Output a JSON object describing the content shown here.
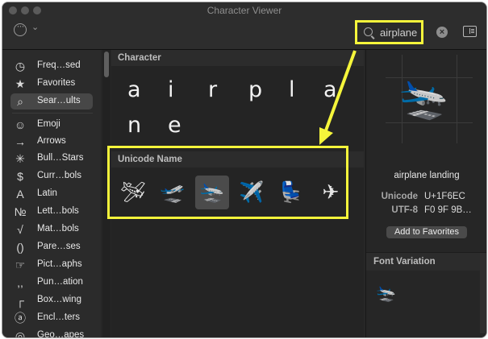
{
  "window": {
    "title": "Character Viewer"
  },
  "search": {
    "value": "airplane"
  },
  "sidebar": {
    "items": [
      {
        "label": "Freq…sed",
        "icon": "◷",
        "icon_name": "clock-icon"
      },
      {
        "label": "Favorites",
        "icon": "★",
        "icon_name": "star-icon"
      },
      {
        "label": "Sear…ults",
        "icon": "⌕",
        "icon_name": "search-icon",
        "selected": true
      },
      {
        "label": "Emoji",
        "icon": "☺",
        "icon_name": "emoji-icon"
      },
      {
        "label": "Arrows",
        "icon": "→",
        "icon_name": "arrow-icon"
      },
      {
        "label": "Bull…Stars",
        "icon": "✳",
        "icon_name": "bullets-stars-icon"
      },
      {
        "label": "Curr…bols",
        "icon": "$",
        "icon_name": "currency-icon"
      },
      {
        "label": "Latin",
        "icon": "A",
        "icon_name": "latin-icon"
      },
      {
        "label": "Lett…bols",
        "icon": "№",
        "icon_name": "letterlike-icon"
      },
      {
        "label": "Mat…bols",
        "icon": "√",
        "icon_name": "math-icon"
      },
      {
        "label": "Pare…ses",
        "icon": "()",
        "icon_name": "parentheses-icon"
      },
      {
        "label": "Pict…aphs",
        "icon": "☞",
        "icon_name": "pictographs-icon"
      },
      {
        "label": "Pun…ation",
        "icon": ",,",
        "icon_name": "punctuation-icon"
      },
      {
        "label": "Box…wing",
        "icon": "┌",
        "icon_name": "box-drawing-icon"
      },
      {
        "label": "Encl…ters",
        "icon": "ⓐ",
        "icon_name": "enclosed-icon"
      },
      {
        "label": "Geo…apes",
        "icon": "◎",
        "icon_name": "geometric-shapes-icon"
      }
    ]
  },
  "main": {
    "character_section": "Character",
    "characters": [
      "a",
      "i",
      "r",
      "p",
      "l",
      "a",
      "n",
      "e"
    ],
    "unicode_section": "Unicode Name",
    "candidates": [
      {
        "char": "🛩",
        "name": "small airplane"
      },
      {
        "char": "🛫",
        "name": "airplane departure"
      },
      {
        "char": "🛬",
        "name": "airplane landing",
        "selected": true
      },
      {
        "char": "✈️",
        "name": "airplane"
      },
      {
        "char": "💺",
        "name": "seat"
      },
      {
        "char": "✈",
        "name": "airplane"
      }
    ]
  },
  "detail": {
    "preview_char": "🛬",
    "name": "airplane landing",
    "unicode_label": "Unicode",
    "unicode_value": "U+1F6EC",
    "utf8_label": "UTF-8",
    "utf8_value": "F0 9F 9B…",
    "favorites_button": "Add to Favorites",
    "font_variation_title": "Font Variation",
    "variations": [
      "🛬"
    ]
  },
  "colors": {
    "highlight": "#f5f53b",
    "background": "#272727"
  }
}
